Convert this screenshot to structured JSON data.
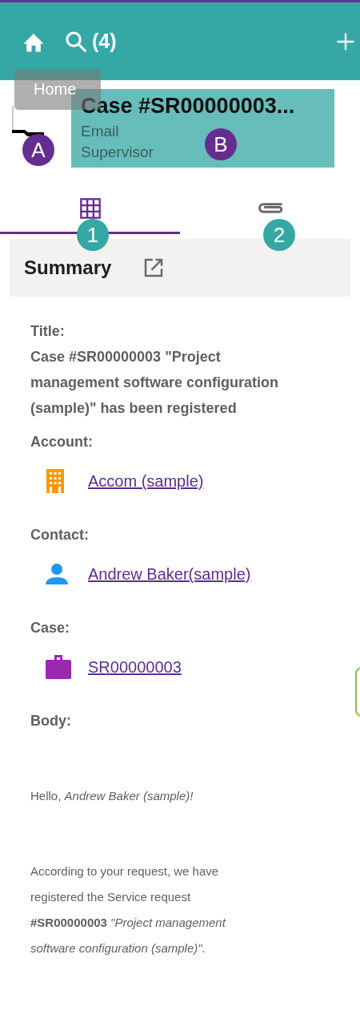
{
  "toolbar": {
    "search_count": "(4)"
  },
  "tooltip": {
    "text": "Home"
  },
  "header": {
    "title": "Case #SR00000003...",
    "lines": [
      "Email",
      "Supervisor"
    ],
    "highlighted": true
  },
  "callouts": [
    {
      "label": "A",
      "color": "#662d91"
    },
    {
      "label": "B",
      "color": "#662d91"
    },
    {
      "label": "1",
      "color": "#35a8a6"
    },
    {
      "label": "2",
      "color": "#35a8a6"
    }
  ],
  "tabs": [
    {
      "kind": "grid",
      "selected": true
    },
    {
      "kind": "attachment",
      "selected": false
    }
  ],
  "section": {
    "title": "Summary"
  },
  "fields": [
    {
      "label": "Title:",
      "kind": "text",
      "value": "Case #SR00000003 \"Project management software configuration (sample)\" has been registered"
    },
    {
      "label": "Account:",
      "kind": "account",
      "value": "Accom (sample)"
    },
    {
      "label": "Contact:",
      "kind": "contact",
      "value": "Andrew Baker(sample)"
    },
    {
      "label": "Case:",
      "kind": "case",
      "value": "SR00000003"
    }
  ],
  "body": {
    "label": "Body:",
    "paragraphs": [
      "Hello, *Andrew Baker (sample)!*",
      "According to your request, we have registered the Service request **#SR00000003** *\"Project management software configuration (sample)\"*."
    ]
  }
}
